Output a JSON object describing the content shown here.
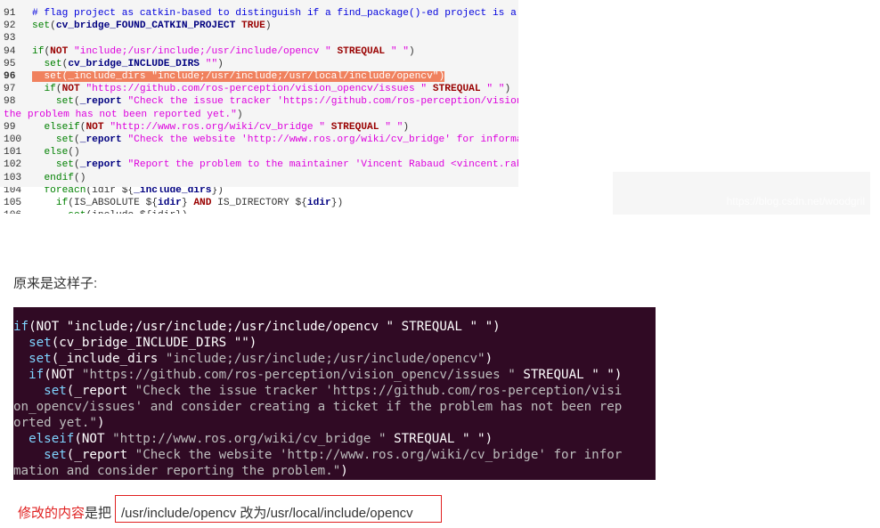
{
  "colors": {
    "code_bg": "#f5f5f5",
    "keyword": "#990000",
    "func": "#008000",
    "string": "#dd00dd",
    "comment": "#0000dd",
    "var": "#000080",
    "highlight": "#f0815e",
    "term_bg": "#300a24",
    "term_fn": "#8be9fd",
    "term_str": "#d7d7d7",
    "term_kw": "#ffffff",
    "accent_red": "#e02020"
  },
  "top_code": {
    "lines": [
      {
        "num": "91",
        "segs": [
          {
            "c": "comment",
            "t": "# flag project as catkin-based to distinguish if a find_package()-ed project is a catkin project"
          }
        ]
      },
      {
        "num": "92",
        "segs": [
          {
            "c": "func",
            "t": "set"
          },
          {
            "c": "plain",
            "t": "("
          },
          {
            "c": "var",
            "t": "cv_bridge_FOUND_CATKIN_PROJECT"
          },
          {
            "c": "plain",
            "t": " "
          },
          {
            "c": "kwv",
            "t": "TRUE"
          },
          {
            "c": "plain",
            "t": ")"
          }
        ]
      },
      {
        "num": "93",
        "segs": []
      },
      {
        "num": "94",
        "segs": [
          {
            "c": "func",
            "t": "if"
          },
          {
            "c": "plain",
            "t": "("
          },
          {
            "c": "kw",
            "t": "NOT"
          },
          {
            "c": "plain",
            "t": " "
          },
          {
            "c": "string",
            "t": "\"include;/usr/include;/usr/include/opencv \""
          },
          {
            "c": "plain",
            "t": " "
          },
          {
            "c": "kw",
            "t": "STREQUAL"
          },
          {
            "c": "plain",
            "t": " "
          },
          {
            "c": "string",
            "t": "\" \""
          },
          {
            "c": "plain",
            "t": ")"
          }
        ]
      },
      {
        "num": "95",
        "segs": [
          {
            "c": "plain",
            "t": "  "
          },
          {
            "c": "func",
            "t": "set"
          },
          {
            "c": "plain",
            "t": "("
          },
          {
            "c": "var",
            "t": "cv_bridge_INCLUDE_DIRS"
          },
          {
            "c": "plain",
            "t": " "
          },
          {
            "c": "string",
            "t": "\"\""
          },
          {
            "c": "plain",
            "t": ")"
          }
        ]
      },
      {
        "num": "96",
        "hl": true,
        "segs": [
          {
            "c": "hl",
            "t": "  set(_include_dirs \"include;/usr/include;/usr/local/include/opencv\")"
          }
        ]
      },
      {
        "num": "97",
        "segs": [
          {
            "c": "plain",
            "t": "  "
          },
          {
            "c": "func",
            "t": "if"
          },
          {
            "c": "plain",
            "t": "("
          },
          {
            "c": "kw",
            "t": "NOT"
          },
          {
            "c": "plain",
            "t": " "
          },
          {
            "c": "string",
            "t": "\"https://github.com/ros-perception/vision_opencv/issues \""
          },
          {
            "c": "plain",
            "t": " "
          },
          {
            "c": "kw",
            "t": "STREQUAL"
          },
          {
            "c": "plain",
            "t": " "
          },
          {
            "c": "string",
            "t": "\" \""
          },
          {
            "c": "plain",
            "t": ")"
          }
        ]
      },
      {
        "num": "98",
        "segs": [
          {
            "c": "plain",
            "t": "    "
          },
          {
            "c": "func",
            "t": "set"
          },
          {
            "c": "plain",
            "t": "("
          },
          {
            "c": "var",
            "t": "_report"
          },
          {
            "c": "plain",
            "t": " "
          },
          {
            "c": "string",
            "t": "\"Check the issue tracker 'https://github.com/ros-perception/vision_opencv/issues' and consider creating a ticket if"
          }
        ]
      },
      {
        "num": "",
        "segs": [
          {
            "c": "string",
            "t": "the problem has not been reported yet.\""
          },
          {
            "c": "plain",
            "t": ")"
          }
        ]
      },
      {
        "num": "99",
        "segs": [
          {
            "c": "plain",
            "t": "  "
          },
          {
            "c": "func",
            "t": "elseif"
          },
          {
            "c": "plain",
            "t": "("
          },
          {
            "c": "kw",
            "t": "NOT"
          },
          {
            "c": "plain",
            "t": " "
          },
          {
            "c": "string",
            "t": "\"http://www.ros.org/wiki/cv_bridge \""
          },
          {
            "c": "plain",
            "t": " "
          },
          {
            "c": "kw",
            "t": "STREQUAL"
          },
          {
            "c": "plain",
            "t": " "
          },
          {
            "c": "string",
            "t": "\" \""
          },
          {
            "c": "plain",
            "t": ")"
          }
        ]
      },
      {
        "num": "100",
        "segs": [
          {
            "c": "plain",
            "t": "    "
          },
          {
            "c": "func",
            "t": "set"
          },
          {
            "c": "plain",
            "t": "("
          },
          {
            "c": "var",
            "t": "_report"
          },
          {
            "c": "plain",
            "t": " "
          },
          {
            "c": "string",
            "t": "\"Check the website 'http://www.ros.org/wiki/cv_bridge' for information and consider reporting the problem.\""
          },
          {
            "c": "plain",
            "t": ")"
          }
        ]
      },
      {
        "num": "101",
        "segs": [
          {
            "c": "plain",
            "t": "  "
          },
          {
            "c": "func",
            "t": "else"
          },
          {
            "c": "plain",
            "t": "()"
          }
        ]
      },
      {
        "num": "102",
        "segs": [
          {
            "c": "plain",
            "t": "    "
          },
          {
            "c": "func",
            "t": "set"
          },
          {
            "c": "plain",
            "t": "("
          },
          {
            "c": "var",
            "t": "_report"
          },
          {
            "c": "plain",
            "t": " "
          },
          {
            "c": "string",
            "t": "\"Report the problem to the maintainer 'Vincent Rabaud <vincent.rabaud@gmail.com>' and request to fix the problem.\""
          },
          {
            "c": "plain",
            "t": ")"
          }
        ]
      },
      {
        "num": "103",
        "segs": [
          {
            "c": "plain",
            "t": "  "
          },
          {
            "c": "func",
            "t": "endif"
          },
          {
            "c": "plain",
            "t": "()"
          }
        ]
      },
      {
        "num": "104",
        "segs": [
          {
            "c": "plain",
            "t": "  "
          },
          {
            "c": "func",
            "t": "foreach"
          },
          {
            "c": "plain",
            "t": "(idir ${"
          },
          {
            "c": "var",
            "t": "_include_dirs"
          },
          {
            "c": "plain",
            "t": "})"
          }
        ]
      },
      {
        "num": "105",
        "segs": [
          {
            "c": "plain",
            "t": "    "
          },
          {
            "c": "func",
            "t": "if"
          },
          {
            "c": "plain",
            "t": "(IS_ABSOLUTE ${"
          },
          {
            "c": "var",
            "t": "idir"
          },
          {
            "c": "plain",
            "t": "} "
          },
          {
            "c": "kw",
            "t": "AND"
          },
          {
            "c": "plain",
            "t": " IS_DIRECTORY ${"
          },
          {
            "c": "var",
            "t": "idir"
          },
          {
            "c": "plain",
            "t": "})"
          }
        ]
      },
      {
        "num": "106",
        "segs": [
          {
            "c": "plain",
            "t": "      "
          },
          {
            "c": "func",
            "t": "set"
          },
          {
            "c": "plain",
            "t": "(include ${idir})"
          }
        ]
      }
    ]
  },
  "watermark": "https://blog.csdn.net/woodgril",
  "paragraph": "原来是这样子:",
  "terminal": {
    "lines": [
      [
        {
          "c": "kw",
          "t": "if"
        },
        {
          "c": "plain",
          "t": "(NOT \"include;/usr/include;/usr/include/opencv \" STREQUAL \" \")"
        }
      ],
      [
        {
          "c": "plain",
          "t": "  "
        },
        {
          "c": "fn",
          "t": "set"
        },
        {
          "c": "plain",
          "t": "(cv_bridge_INCLUDE_DIRS \"\")"
        }
      ],
      [
        {
          "c": "plain",
          "t": "  "
        },
        {
          "c": "fn",
          "t": "set"
        },
        {
          "c": "plain",
          "t": "(_include_dirs "
        },
        {
          "c": "str",
          "t": "\"include;/usr/include;/usr/include/opencv\""
        },
        {
          "c": "plain",
          "t": ")"
        }
      ],
      [
        {
          "c": "plain",
          "t": "  "
        },
        {
          "c": "kw",
          "t": "if"
        },
        {
          "c": "plain",
          "t": "(NOT "
        },
        {
          "c": "str",
          "t": "\"https://github.com/ros-perception/vision_opencv/issues \""
        },
        {
          "c": "plain",
          "t": " STREQUAL \" \")"
        }
      ],
      [
        {
          "c": "plain",
          "t": "    "
        },
        {
          "c": "fn",
          "t": "set"
        },
        {
          "c": "plain",
          "t": "(_report "
        },
        {
          "c": "str",
          "t": "\"Check the issue tracker 'https://github.com/ros-perception/visi"
        }
      ],
      [
        {
          "c": "str",
          "t": "on_opencv/issues' and consider creating a ticket if the problem has not been rep"
        }
      ],
      [
        {
          "c": "str",
          "t": "orted yet.\""
        },
        {
          "c": "plain",
          "t": ")"
        }
      ],
      [
        {
          "c": "plain",
          "t": "  "
        },
        {
          "c": "kw",
          "t": "elseif"
        },
        {
          "c": "plain",
          "t": "(NOT "
        },
        {
          "c": "str",
          "t": "\"http://www.ros.org/wiki/cv_bridge \""
        },
        {
          "c": "plain",
          "t": " STREQUAL \" \")"
        }
      ],
      [
        {
          "c": "plain",
          "t": "    "
        },
        {
          "c": "fn",
          "t": "set"
        },
        {
          "c": "plain",
          "t": "(_report "
        },
        {
          "c": "str",
          "t": "\"Check the website 'http://www.ros.org/wiki/cv_bridge' for infor"
        }
      ],
      [
        {
          "c": "str",
          "t": "mation and consider reporting the problem.\""
        },
        {
          "c": "plain",
          "t": ")"
        }
      ]
    ]
  },
  "caption": {
    "red": "修改的内容",
    "rest": "是把",
    "boxed": "/usr/include/opencv 改为/usr/local/include/opencv"
  }
}
